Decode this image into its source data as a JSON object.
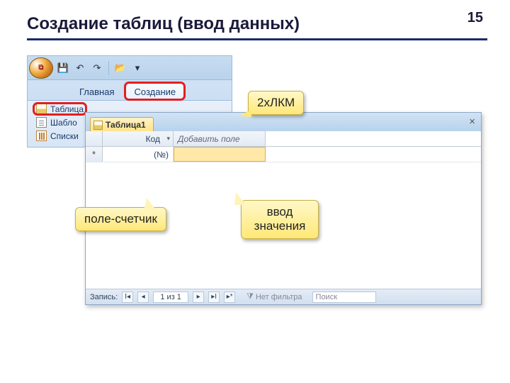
{
  "slide": {
    "title": "Создание таблиц (ввод данных)",
    "number": "15"
  },
  "ribbon": {
    "tabs": {
      "home": "Главная",
      "create": "Создание"
    },
    "group": {
      "table": "Таблица",
      "templates": "Шабло",
      "lists": "Списки"
    }
  },
  "datasheet": {
    "tab": "Таблица1",
    "columns": {
      "id": "Код",
      "add": "Добавить поле"
    },
    "newrow_id": "(№)",
    "status": {
      "label": "Запись:",
      "position": "1 из 1",
      "filter": "Нет фильтра",
      "search": "Поиск"
    }
  },
  "callouts": {
    "dblclick": "2хЛКМ",
    "counter": "поле-счетчик",
    "input": "ввод значения"
  }
}
